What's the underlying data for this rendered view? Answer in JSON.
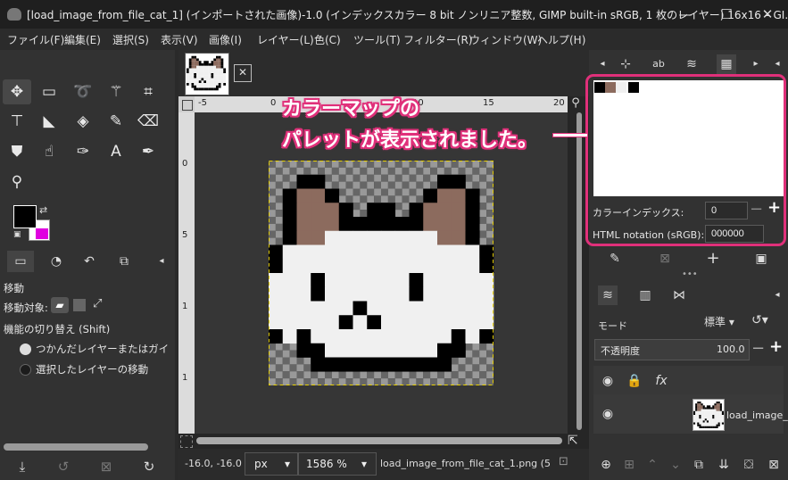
{
  "window": {
    "title": "[load_image_from_file_cat_1] (インポートされた画像)-1.0 (インデックスカラー 8 bit ノンリニア整数, GIMP built-in sRGB, 1 枚のレイヤー) 16x16 – GI...",
    "minimize": "—",
    "maximize": "☐",
    "close": "✕"
  },
  "menu": [
    "ファイル(F)",
    "編集(E)",
    "選択(S)",
    "表示(V)",
    "画像(I)",
    "レイヤー(L)",
    "色(C)",
    "ツール(T)",
    "フィルター(R)",
    "ウィンドウ(W)",
    "ヘルプ(H)"
  ],
  "tool_options": {
    "title": "移動",
    "move_target_label": "移動対象:",
    "toggle_title": "機能の切り替え (Shift)",
    "radio1": "つかんだレイヤーまたはガイドの移",
    "radio2": "選択したレイヤーの移動"
  },
  "canvas": {
    "hruler_ticks": [
      "-5",
      "0",
      "5",
      "10",
      "15",
      "20"
    ],
    "vruler_ticks": [
      "0",
      "5",
      "1",
      "1"
    ]
  },
  "status": {
    "coords": "-16.0, -16.0",
    "unit": "px",
    "zoom": "1586 %",
    "file": "load_image_from_file_cat_1.png (5..."
  },
  "colormap": {
    "color_index_label": "カラーインデックス:",
    "color_index_value": "0",
    "html_label": "HTML notation (sRGB):",
    "html_value": "000000",
    "swatches": [
      "#000000",
      "#8c6b5e",
      "#f0f0f0",
      "#ffffff",
      "#000000"
    ]
  },
  "layers": {
    "mode_label": "モード",
    "mode_value": "標準",
    "opacity_label": "不透明度",
    "opacity_value": "100.0",
    "layer_name": "load_image_"
  },
  "annotation": {
    "line1": "カラーマップの",
    "line2": "パレットが表示されました。",
    "highlight_color": "#e0307a"
  },
  "cat_pixels": [
    "................",
    "..XX........XX..",
    ".XBBX......XBBX.",
    ".XBBBX.XX.XBBBX.",
    ".XBBBXXXXXXBBBX.",
    ".XBBWWWWWWWWBBX.",
    "XWWWWWWWWWWWWWWX",
    "XWWWWWWWWWWWWWWX",
    "WWWXWWWWWWXWWWWW",
    "WWWXWWWWWWXWWWWW",
    "WWWWWWXWWWWWWWWW",
    "WWWWWXWXWWWWWWWW",
    "XWXWWWWWWWWWWXWX",
    "..XXWWWWWWWWXX..",
    "...XXXXXXXXXX...",
    "................"
  ]
}
